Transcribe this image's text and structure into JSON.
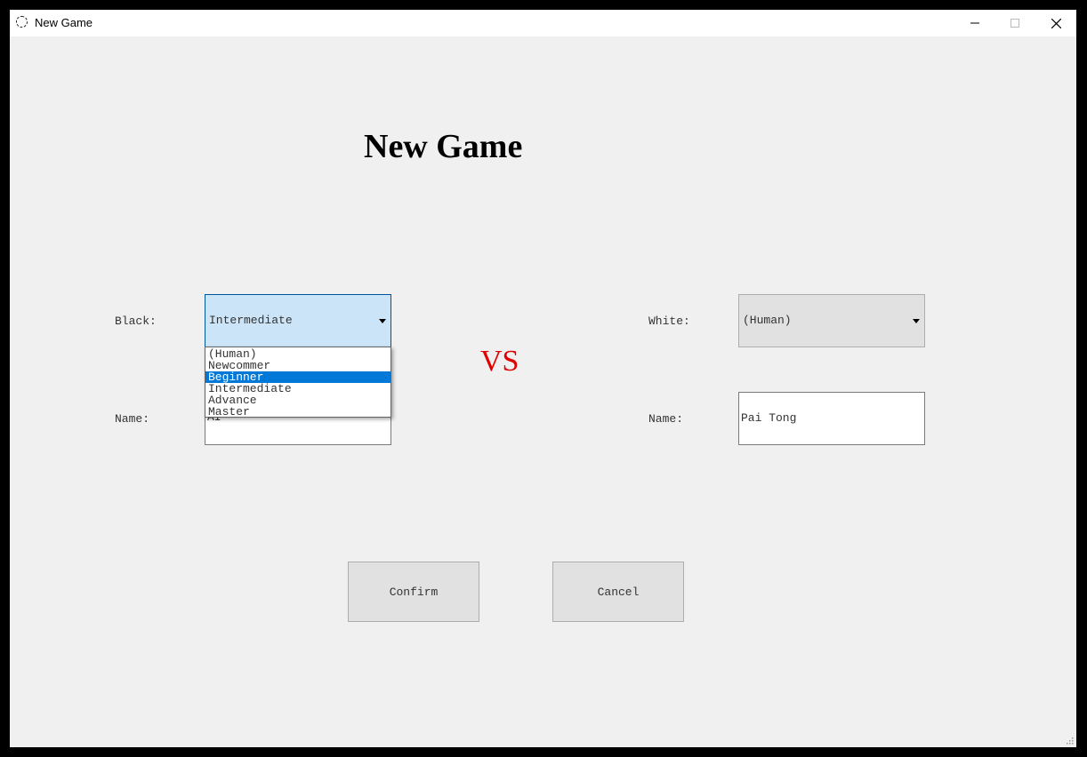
{
  "window": {
    "title": "New Game"
  },
  "main": {
    "heading": "New Game",
    "vs_text": "VS"
  },
  "black": {
    "label": "Black:",
    "selected": "Intermediate",
    "name_label": "Name:",
    "name_value": "AI"
  },
  "white": {
    "label": "White:",
    "selected": "(Human)",
    "name_label": "Name:",
    "name_value": "Pai Tong"
  },
  "dropdown": {
    "items": [
      "(Human)",
      "Newcommer",
      "Beginner",
      "Intermediate",
      "Advance",
      "Master"
    ],
    "highlighted": "Beginner"
  },
  "buttons": {
    "confirm": "Confirm",
    "cancel": "Cancel"
  },
  "colors": {
    "vs": "#e00000",
    "highlight": "#0078d7",
    "combo_active": "#cce4f7"
  }
}
